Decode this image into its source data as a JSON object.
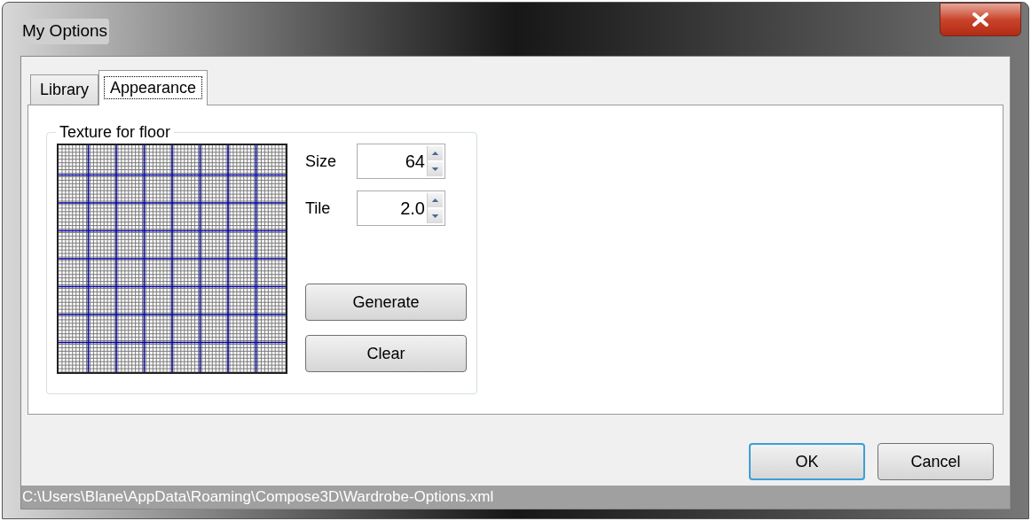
{
  "window": {
    "title": "My Options"
  },
  "tabs": [
    {
      "label": "Library",
      "selected": false
    },
    {
      "label": "Appearance",
      "selected": true
    }
  ],
  "texture_group": {
    "title": "Texture for floor",
    "fields": [
      {
        "label": "Size",
        "value": "64"
      },
      {
        "label": "Tile",
        "value": "2.0"
      }
    ],
    "buttons": [
      "Generate",
      "Clear"
    ]
  },
  "dialog_buttons": [
    {
      "label": "OK",
      "default": true
    },
    {
      "label": "Cancel",
      "default": false
    }
  ],
  "status_bar": "C:\\Users\\Blane\\AppData\\Roaming\\Compose3D\\Wardrobe-Options.xml"
}
